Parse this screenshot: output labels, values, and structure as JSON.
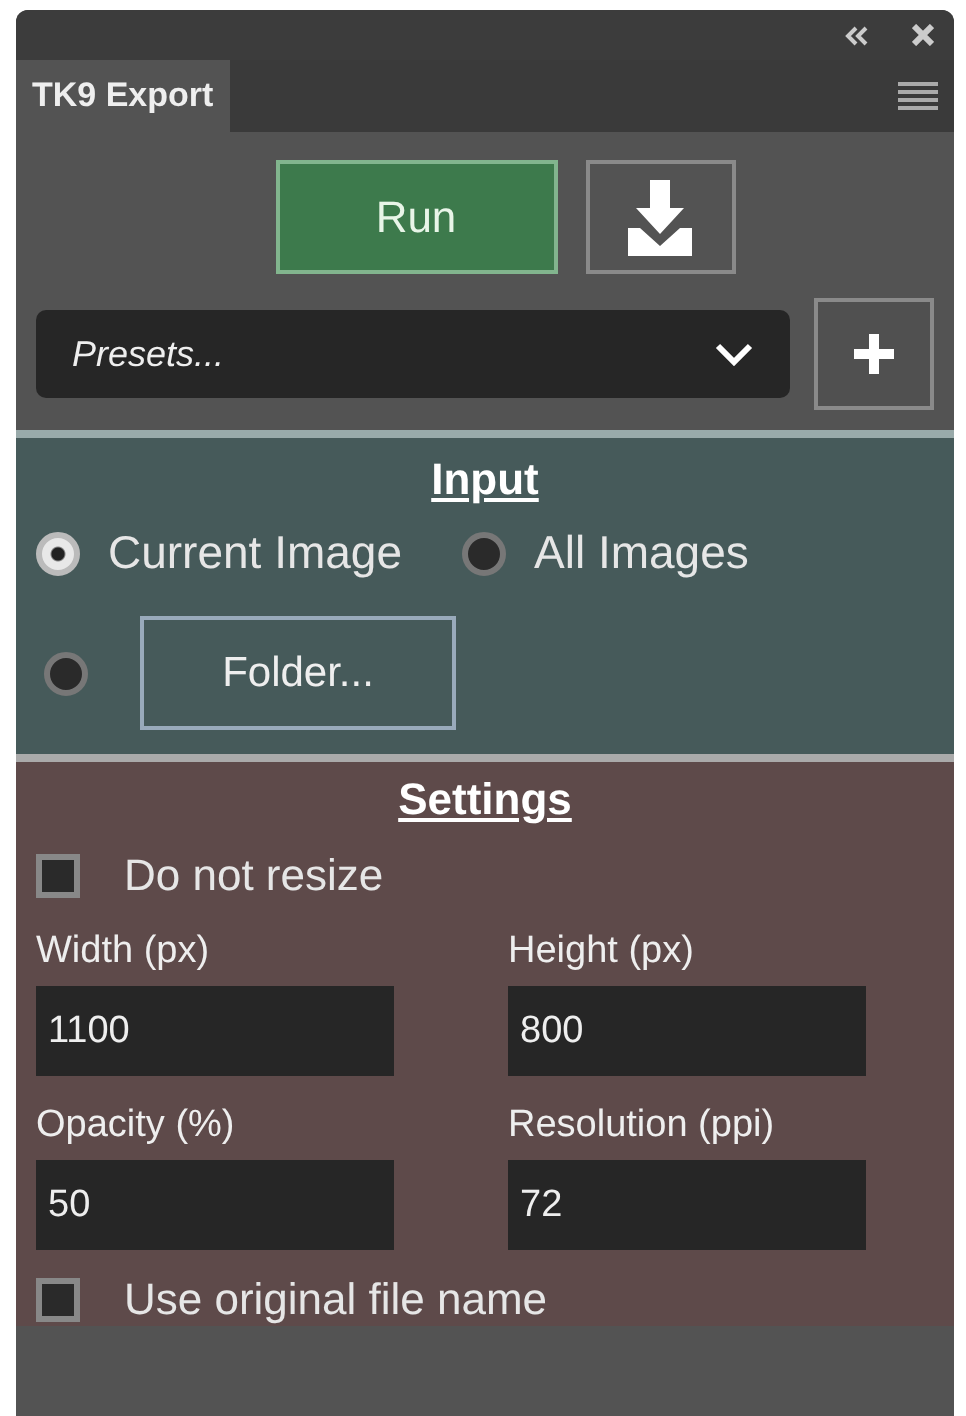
{
  "panel": {
    "tabs": [
      {
        "label": "TK9 Export",
        "selected": true
      }
    ]
  },
  "run_button": "Run",
  "presets": {
    "value": "Presets..."
  },
  "input": {
    "title": "Input",
    "sources": [
      {
        "label": "Current Image",
        "selected": true,
        "kind": "text"
      },
      {
        "label": "All Images",
        "selected": false,
        "kind": "text"
      },
      {
        "label": "Folder...",
        "selected": false,
        "kind": "button"
      }
    ]
  },
  "settings": {
    "title": "Settings",
    "rows": [
      {
        "kind": "checkbox",
        "label": "Do not resize",
        "checked": false
      },
      {
        "kind": "fields",
        "fields": [
          {
            "label": "Width (px)",
            "value": "1100"
          },
          {
            "label": "Height (px)",
            "value": "800"
          }
        ]
      },
      {
        "kind": "fields",
        "fields": [
          {
            "label": "Opacity (%)",
            "value": "50"
          },
          {
            "label": "Resolution (ppi)",
            "value": "72"
          }
        ]
      },
      {
        "kind": "checkbox",
        "label": "Use original file name",
        "checked": false
      }
    ]
  }
}
